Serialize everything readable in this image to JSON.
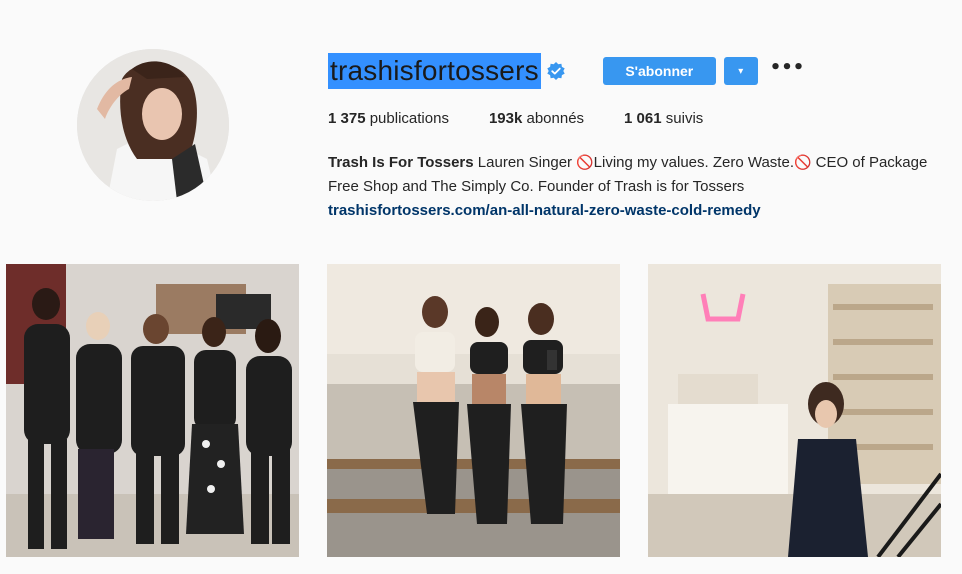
{
  "profile": {
    "username": "trashisfortossers",
    "verified": true,
    "follow_label": "S'abonner",
    "dropdown_icon": "▾",
    "more_icon": "•••"
  },
  "stats": {
    "posts_count": "1 375",
    "posts_label": "publications",
    "followers_count": "193k",
    "followers_label": "abonnés",
    "following_count": "1 061",
    "following_label": "suivis"
  },
  "bio": {
    "name": "Trash Is For Tossers",
    "text_1": "Lauren Singer ",
    "icon_1": "🚫",
    "text_2": "Living my values. Zero Waste.",
    "icon_2": "🚫",
    "text_3": " CEO of Package Free Shop and The Simply Co. Founder of Trash is for Tossers",
    "link": "trashisfortossers.com/an-all-natural-zero-waste-cold-remedy"
  },
  "posts": [
    {
      "description": "group-photo"
    },
    {
      "description": "mirror-selfie-studio"
    },
    {
      "description": "shop-interior"
    }
  ],
  "colors": {
    "accent": "#3897f0",
    "selection": "#3390ff",
    "link": "#003569",
    "background": "#fafafa"
  }
}
